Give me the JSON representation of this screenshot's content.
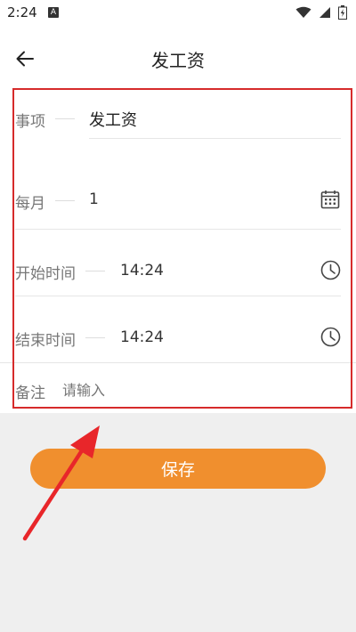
{
  "status_bar": {
    "time": "2:24",
    "notification_badge": "A",
    "icons": [
      "wifi-icon",
      "signal-icon",
      "battery-icon"
    ]
  },
  "app_bar": {
    "title": "发工资",
    "back_icon": "arrow-left-icon"
  },
  "form": {
    "item": {
      "label": "事项",
      "value": "发工资"
    },
    "monthly": {
      "label": "每月",
      "value": "1",
      "icon": "calendar-icon"
    },
    "start_time": {
      "label": "开始时间",
      "value": "14:24",
      "icon": "clock-icon"
    },
    "end_time": {
      "label": "结束时间",
      "value": "14:24",
      "icon": "clock-icon"
    },
    "remark": {
      "label": "备注",
      "placeholder": "请输入"
    }
  },
  "save_button": {
    "label": "保存"
  },
  "colors": {
    "accent": "#f08f2e",
    "annotation_red": "#d62b2b",
    "background": "#efefef"
  }
}
